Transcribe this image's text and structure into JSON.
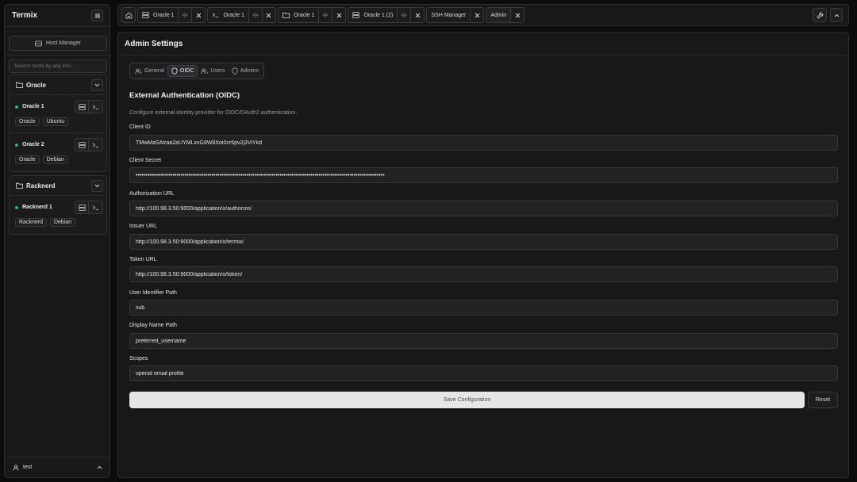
{
  "sidebar": {
    "title": "Termix",
    "host_manager_label": "Host Manager",
    "search_placeholder": "Search hosts by any info...",
    "groups": [
      {
        "name": "Oracle",
        "hosts": [
          {
            "name": "Oracle 1",
            "tags": [
              "Oracle",
              "Ubuntu"
            ],
            "status": "online"
          },
          {
            "name": "Oracle 2",
            "tags": [
              "Oracle",
              "Debian"
            ],
            "status": "online"
          }
        ]
      },
      {
        "name": "Racknerd",
        "hosts": [
          {
            "name": "Racknerd 1",
            "tags": [
              "Racknerd",
              "Debian"
            ],
            "status": "online"
          }
        ]
      }
    ],
    "user": "test"
  },
  "tabs": [
    {
      "icon": "server-icon",
      "label": "Oracle 1"
    },
    {
      "icon": "terminal-icon",
      "label": "Oracle 1"
    },
    {
      "icon": "folder-icon",
      "label": "Oracle 1"
    },
    {
      "icon": "server-icon",
      "label": "Oracle 1 (2)"
    },
    {
      "label": "SSH Manager"
    },
    {
      "label": "Admin"
    }
  ],
  "main": {
    "title": "Admin Settings",
    "subtabs": [
      "General",
      "OIDC",
      "Users",
      "Admins"
    ],
    "active_subtab": "OIDC",
    "section_title": "External Authentication (OIDC)",
    "section_desc": "Configure external identity provider for OIDC/OAuth2 authentication.",
    "fields": [
      {
        "label": "Client ID",
        "value": "TMwMaSAtraa2aUYMLxvG8W8Xoi0cr6pv2j3ViYkd"
      },
      {
        "label": "Client Secret",
        "value": "••••••••••••••••••••••••••••••••••••••••••••••••••••••••••••••••••••••••••••••••••••••••••••••••••••••••••••••••••••••••••••••••"
      },
      {
        "label": "Authorization URL",
        "value": "http://100.98.3.50:9000/application/o/authorize/"
      },
      {
        "label": "Issuer URL",
        "value": "http://100.98.3.50:9000/application/o/termix/"
      },
      {
        "label": "Token URL",
        "value": "http://100.98.3.50:9000/application/o/token/"
      },
      {
        "label": "User Identifier Path",
        "value": "sub"
      },
      {
        "label": "Display Name Path",
        "value": "preferred_username"
      },
      {
        "label": "Scopes",
        "value": "openid email profile"
      }
    ],
    "save_label": "Save Configuration",
    "reset_label": "Reset"
  },
  "colors": {
    "background": "#0c0c0d",
    "panel": "#18181a",
    "status_online": "#1fb970",
    "primary_button": "#e6e6e6"
  }
}
